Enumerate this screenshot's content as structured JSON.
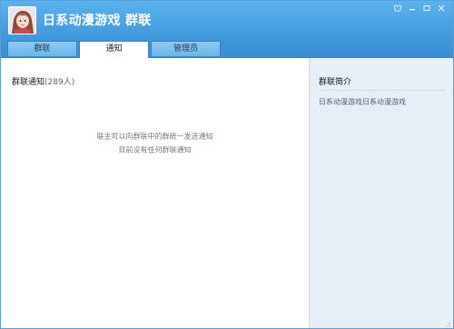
{
  "window": {
    "title": "日系动漫游戏 群联",
    "controls": [
      {
        "name": "skin-icon"
      },
      {
        "name": "minimize-icon"
      },
      {
        "name": "maximize-icon"
      },
      {
        "name": "close-icon"
      }
    ]
  },
  "tabs": [
    {
      "label": "群联",
      "active": false
    },
    {
      "label": "通知",
      "active": true
    },
    {
      "label": "管理员",
      "active": false
    }
  ],
  "notifications": {
    "title": "群联通知",
    "count": "(289人)",
    "empty_line1": "联主可以向群联中的群统一发送通知",
    "empty_line2": "目前没有任何群联通知"
  },
  "intro": {
    "title": "群联简介",
    "description": "日系动漫游戏日系动漫游戏"
  },
  "colors": {
    "titlebar": "#4aa6e6",
    "sidebar": "#e6eff7",
    "tab_inactive": "#7dbdee"
  }
}
